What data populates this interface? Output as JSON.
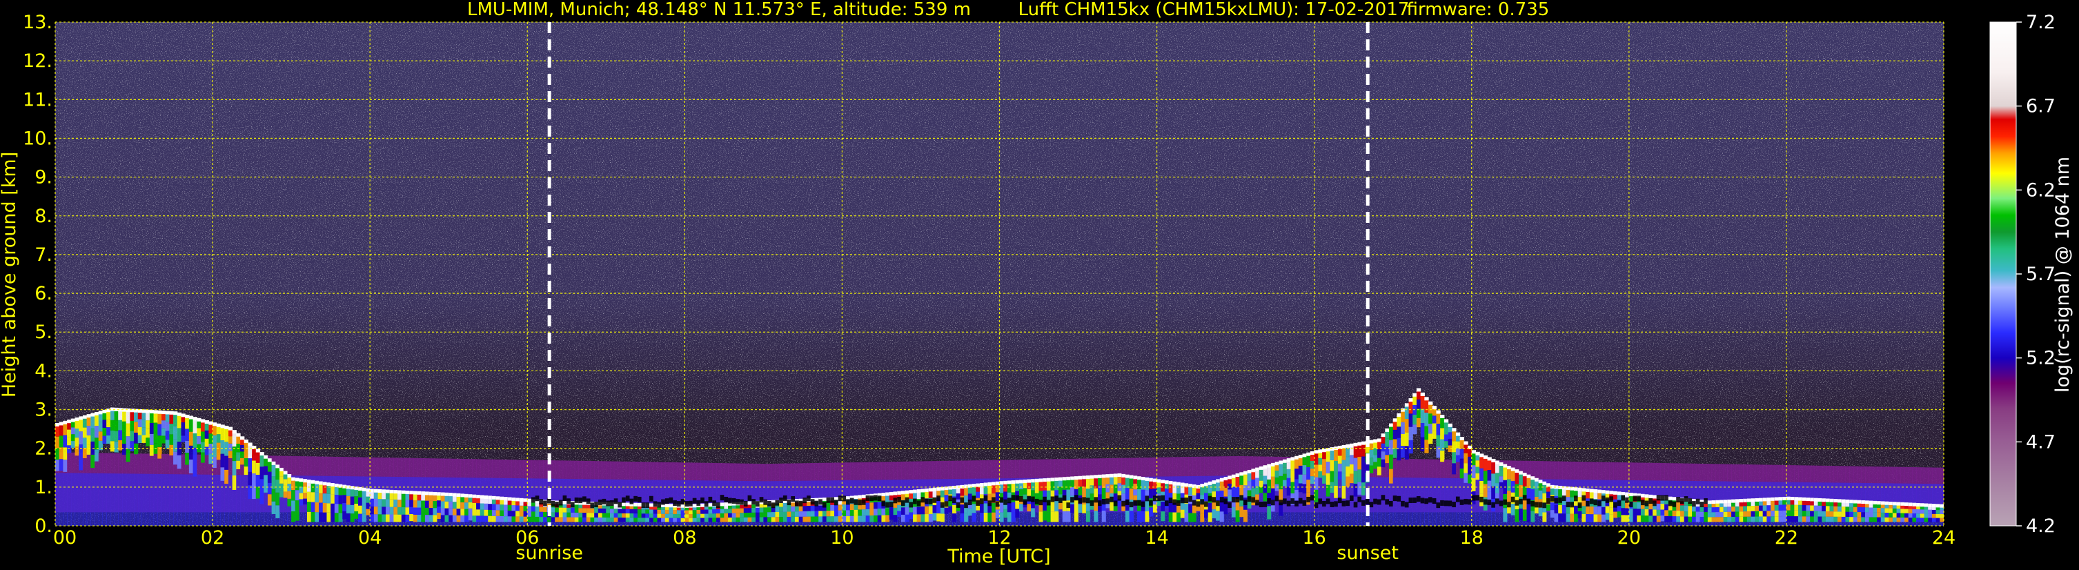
{
  "chart_data": {
    "type": "heatmap",
    "title_parts": [
      "LMU-MIM, Munich; 48.148° N 11.573° E, altitude: 539 m",
      "Lufft CHM15kx (CHM15kxLMU): 17-02-2017",
      "firmware: 0.735"
    ],
    "xlabel": "Time [UTC]",
    "ylabel": "Height above ground [km]",
    "xlim": [
      0,
      24
    ],
    "ylim": [
      0,
      13
    ],
    "x_ticks": [
      0,
      2,
      4,
      6,
      8,
      10,
      12,
      14,
      16,
      18,
      20,
      22,
      24
    ],
    "x_tick_labels": [
      "00",
      "02",
      "04",
      "06",
      "08",
      "10",
      "12",
      "14",
      "16",
      "18",
      "20",
      "22",
      "24"
    ],
    "y_ticks": [
      0,
      1,
      2,
      3,
      4,
      5,
      6,
      7,
      8,
      9,
      10,
      11,
      12,
      13
    ],
    "y_tick_labels": [
      "0.",
      "1.",
      "2.",
      "3.",
      "4.",
      "5.",
      "6.",
      "7.",
      "8.",
      "9.",
      "10.",
      "11.",
      "12.",
      "13."
    ],
    "grid": true,
    "grid_color": "#ffff00",
    "text_color": "#ffff00",
    "background": "#000000",
    "events": [
      {
        "label": "sunrise",
        "x": 6.28
      },
      {
        "label": "sunset",
        "x": 16.68
      }
    ],
    "colorbar": {
      "label": "log(rc-signal) @ 1064 nm",
      "range": [
        4.2,
        7.2
      ],
      "tick_values": [
        4.2,
        4.7,
        5.2,
        5.7,
        6.2,
        6.7,
        7.2
      ],
      "tick_labels": [
        "4.2",
        "4.7",
        "5.2",
        "5.7",
        "6.2",
        "6.7",
        "7.2"
      ],
      "stops": [
        [
          4.2,
          "#b9a3b5"
        ],
        [
          4.45,
          "#a882a4"
        ],
        [
          4.7,
          "#985e94"
        ],
        [
          4.9,
          "#883c82"
        ],
        [
          5.05,
          "#700070"
        ],
        [
          5.2,
          "#1800c0"
        ],
        [
          5.35,
          "#2a2cff"
        ],
        [
          5.5,
          "#6e7dff"
        ],
        [
          5.62,
          "#a7b8ff"
        ],
        [
          5.72,
          "#3db9c8"
        ],
        [
          5.85,
          "#22c07f"
        ],
        [
          5.95,
          "#0f9a2f"
        ],
        [
          6.05,
          "#00c000"
        ],
        [
          6.15,
          "#7df07d"
        ],
        [
          6.3,
          "#ffff00"
        ],
        [
          6.42,
          "#ffa000"
        ],
        [
          6.52,
          "#ff2200"
        ],
        [
          6.62,
          "#e00000"
        ],
        [
          6.7,
          "#e0d3d3"
        ],
        [
          6.9,
          "#f8f0f0"
        ],
        [
          7.2,
          "#ffffff"
        ]
      ]
    },
    "cloud_layer_top_km": [
      [
        0,
        2.6
      ],
      [
        0.7,
        3.0
      ],
      [
        1.5,
        2.9
      ],
      [
        2.2,
        2.5
      ],
      [
        3.0,
        1.2
      ],
      [
        4.0,
        0.9
      ],
      [
        5.0,
        0.8
      ],
      [
        6.3,
        0.6
      ],
      [
        8.0,
        0.5
      ],
      [
        10.0,
        0.7
      ],
      [
        12.0,
        1.1
      ],
      [
        13.5,
        1.3
      ],
      [
        14.5,
        1.0
      ],
      [
        16.0,
        1.9
      ],
      [
        16.8,
        2.2
      ],
      [
        17.3,
        3.5
      ],
      [
        18.0,
        1.9
      ],
      [
        19.0,
        1.0
      ],
      [
        20.0,
        0.8
      ],
      [
        21.0,
        0.6
      ],
      [
        22.0,
        0.7
      ],
      [
        24.0,
        0.5
      ]
    ],
    "boundary_layer_top_km": [
      [
        0,
        1.9
      ],
      [
        3.0,
        1.8
      ],
      [
        6.0,
        1.7
      ],
      [
        9.0,
        1.6
      ],
      [
        12.0,
        1.7
      ],
      [
        15.0,
        1.8
      ],
      [
        18.0,
        1.7
      ],
      [
        21.0,
        1.6
      ],
      [
        24.0,
        1.5
      ]
    ]
  }
}
